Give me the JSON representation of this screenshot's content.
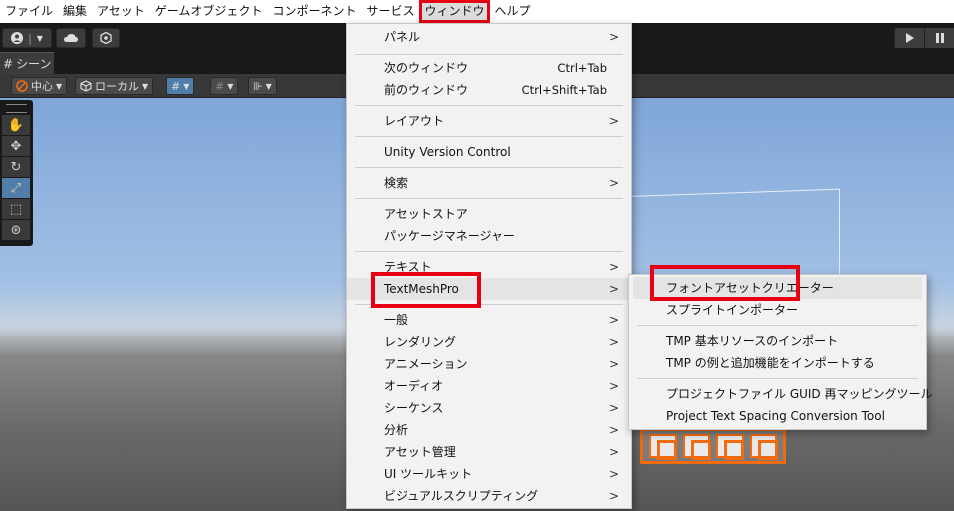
{
  "menubar": {
    "items": [
      "ファイル",
      "編集",
      "アセット",
      "ゲームオブジェクト",
      "コンポーネント",
      "サービス",
      "ウィンドウ",
      "ヘルプ"
    ]
  },
  "scene": {
    "tab_label": "シーン",
    "pivot_label": "中心",
    "space_label": "ローカル"
  },
  "window_menu": {
    "items": [
      {
        "label": "パネル",
        "shortcut": "",
        "submenu": true
      },
      {
        "label": "次のウィンドウ",
        "shortcut": "Ctrl+Tab",
        "submenu": false
      },
      {
        "label": "前のウィンドウ",
        "shortcut": "Ctrl+Shift+Tab",
        "submenu": false
      },
      {
        "label": "レイアウト",
        "shortcut": "",
        "submenu": true
      },
      {
        "label": "Unity Version Control",
        "shortcut": "",
        "submenu": false
      },
      {
        "label": "検索",
        "shortcut": "",
        "submenu": true
      },
      {
        "label": "アセットストア",
        "shortcut": "",
        "submenu": false
      },
      {
        "label": "パッケージマネージャー",
        "shortcut": "",
        "submenu": false
      },
      {
        "label": "テキスト",
        "shortcut": "",
        "submenu": true
      },
      {
        "label": "TextMeshPro",
        "shortcut": "",
        "submenu": true
      },
      {
        "label": "一般",
        "shortcut": "",
        "submenu": true
      },
      {
        "label": "レンダリング",
        "shortcut": "",
        "submenu": true
      },
      {
        "label": "アニメーション",
        "shortcut": "",
        "submenu": true
      },
      {
        "label": "オーディオ",
        "shortcut": "",
        "submenu": true
      },
      {
        "label": "シーケンス",
        "shortcut": "",
        "submenu": true
      },
      {
        "label": "分析",
        "shortcut": "",
        "submenu": true
      },
      {
        "label": "アセット管理",
        "shortcut": "",
        "submenu": true
      },
      {
        "label": "UI ツールキット",
        "shortcut": "",
        "submenu": true
      },
      {
        "label": "ビジュアルスクリプティング",
        "shortcut": "",
        "submenu": true
      }
    ]
  },
  "tmp_submenu": {
    "items": [
      "フォントアセットクリエーター",
      "スプライトインポーター",
      "TMP 基本リソースのインポート",
      "TMP の例と追加機能をインポートする",
      "プロジェクトファイル GUID 再マッピングツール",
      "Project Text Spacing Conversion Tool"
    ]
  },
  "arrow_glyph": ">",
  "colors": {
    "highlight_box": "#e60012",
    "menu_bg": "#f2f2f2"
  }
}
